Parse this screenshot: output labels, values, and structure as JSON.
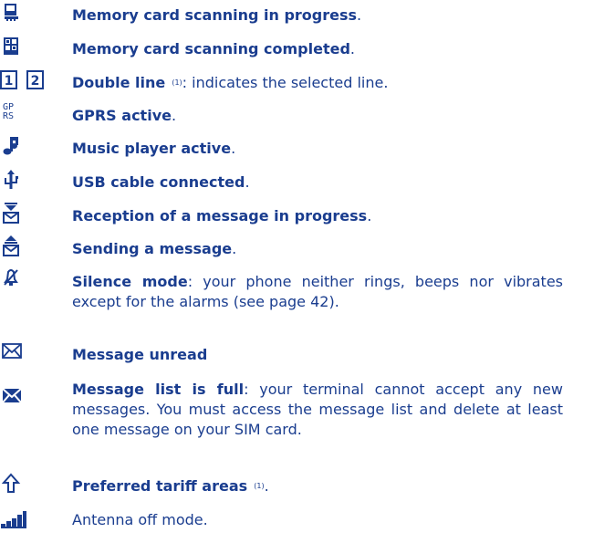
{
  "items": [
    {
      "icon": "memory-card-scanning-icon",
      "bold": "Memory card scanning in progress",
      "rest": "."
    },
    {
      "icon": "memory-card-completed-icon",
      "bold": "Memory card scanning completed",
      "rest": "."
    },
    {
      "icon": "double-line-icon",
      "bold": "Double line",
      "note": "(1)",
      "rest": ": indicates the selected line."
    },
    {
      "icon": "gprs-icon",
      "glyph": "GP\nRS",
      "bold": "GPRS active",
      "rest": "."
    },
    {
      "icon": "music-note-icon",
      "bold": "Music player active",
      "rest": "."
    },
    {
      "icon": "usb-icon",
      "bold": "USB cable connected",
      "rest": "."
    },
    {
      "icon": "message-receiving-icon",
      "bold": "Reception of a message in progress",
      "rest": "."
    },
    {
      "icon": "message-sending-icon",
      "bold": "Sending a message",
      "rest": "."
    },
    {
      "icon": "silence-mode-icon",
      "bold": "Silence mode",
      "rest": ": your phone neither rings, beeps nor vibrates except for the alarms (see page 42)."
    },
    {
      "icon": "message-unread-icon",
      "bold": "Message unread",
      "rest": ""
    },
    {
      "icon": "message-list-full-icon",
      "bold": "Message list is full",
      "rest": ": your terminal cannot accept any new messages. You must access the message list and delete at least one message on your SIM card."
    },
    {
      "icon": "preferred-tariff-icon",
      "bold": "Preferred tariff areas",
      "note": "(1)",
      "rest": "."
    },
    {
      "icon": "antenna-off-icon",
      "bold": "",
      "rest": "Antenna off mode."
    }
  ],
  "colors": {
    "text": "#1a3d8f",
    "icon": "#1a3d8f"
  }
}
